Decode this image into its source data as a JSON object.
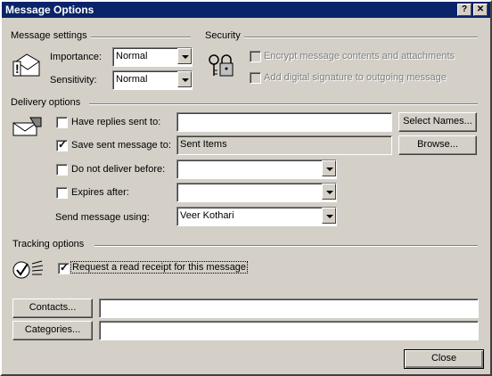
{
  "window": {
    "title": "Message Options",
    "help": "?",
    "close": "✕"
  },
  "message_settings": {
    "title": "Message settings",
    "importance_label": "Importance:",
    "importance_value": "Normal",
    "sensitivity_label": "Sensitivity:",
    "sensitivity_value": "Normal"
  },
  "security": {
    "title": "Security",
    "encrypt_label": "Encrypt message contents and attachments",
    "signature_label": "Add digital signature to outgoing message"
  },
  "delivery": {
    "title": "Delivery options",
    "have_replies_label": "Have replies sent to:",
    "have_replies_value": "",
    "select_names_button": "Select Names...",
    "save_sent_label": "Save sent message to:",
    "save_sent_value": "Sent Items",
    "browse_button": "Browse...",
    "do_not_deliver_label": "Do not deliver before:",
    "do_not_deliver_value": "",
    "expires_label": "Expires after:",
    "expires_value": "",
    "send_using_label": "Send message using:",
    "send_using_value": "Veer Kothari"
  },
  "tracking": {
    "title": "Tracking options",
    "read_receipt_label": "Request a read receipt for this message"
  },
  "footer": {
    "contacts_button": "Contacts...",
    "contacts_value": "",
    "categories_button": "Categories...",
    "categories_value": "",
    "close_button": "Close"
  },
  "checks": {
    "have_replies": false,
    "save_sent": true,
    "do_not_deliver": false,
    "expires": false,
    "encrypt": false,
    "signature": false,
    "read_receipt": true
  },
  "colors": {
    "titlebar": "#0a246a",
    "face": "#d4d0c8"
  }
}
